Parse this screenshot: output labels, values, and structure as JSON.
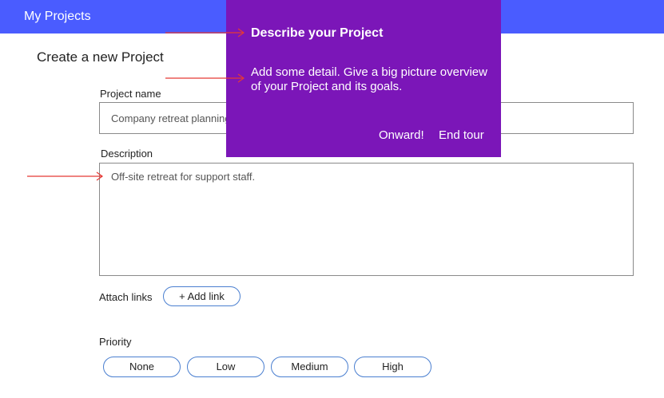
{
  "topbar": {
    "title": "My Projects",
    "color": "#4a5cff"
  },
  "page": {
    "title": "Create a new Project"
  },
  "form": {
    "project_name_label": "Project name",
    "project_name_value": "Company retreat planning",
    "description_label": "Description",
    "description_value": "Off-site retreat for support staff.",
    "attach_links_label": "Attach links",
    "add_link_button": "+ Add link",
    "priority_label": "Priority",
    "priority_options": [
      "None",
      "Low",
      "Medium",
      "High"
    ]
  },
  "tour": {
    "title": "Describe your Project",
    "body": "Add some detail. Give a big picture overview of your Project and its goals.",
    "next_button": "Onward!",
    "end_button": "End tour",
    "background": "#7b16b8"
  },
  "annotations": {
    "arrow_color": "#e53935"
  }
}
